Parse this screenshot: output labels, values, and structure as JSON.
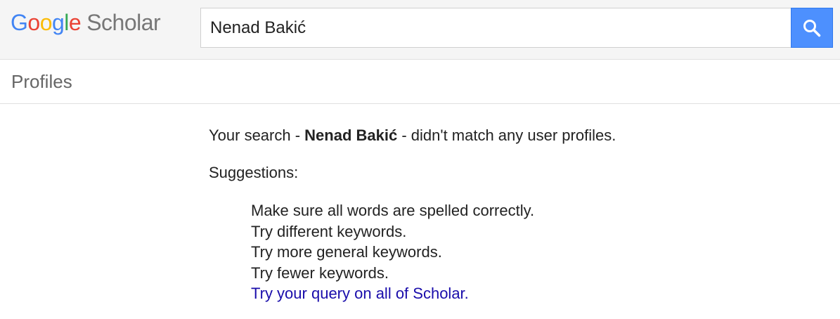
{
  "header": {
    "logo": {
      "word1_letters": [
        {
          "ch": "G",
          "color": "#4285F4"
        },
        {
          "ch": "o",
          "color": "#EA4335"
        },
        {
          "ch": "o",
          "color": "#FBBC05"
        },
        {
          "ch": "g",
          "color": "#4285F4"
        },
        {
          "ch": "l",
          "color": "#34A853"
        },
        {
          "ch": "e",
          "color": "#EA4335"
        }
      ],
      "word2": "Scholar"
    },
    "search": {
      "value": "Nenad Bakić",
      "button_icon": "search-icon"
    }
  },
  "subheader": {
    "title": "Profiles"
  },
  "result": {
    "prefix": "Your search - ",
    "query": "Nenad Bakić",
    "suffix": " - didn't match any user profiles.",
    "suggestions_title": "Suggestions:",
    "suggestions": [
      "Make sure all words are spelled correctly.",
      "Try different keywords.",
      "Try more general keywords.",
      "Try fewer keywords."
    ],
    "scholar_link": "Try your query on all of Scholar."
  },
  "colors": {
    "accent": "#4d90fe",
    "link": "#1a0dab"
  }
}
